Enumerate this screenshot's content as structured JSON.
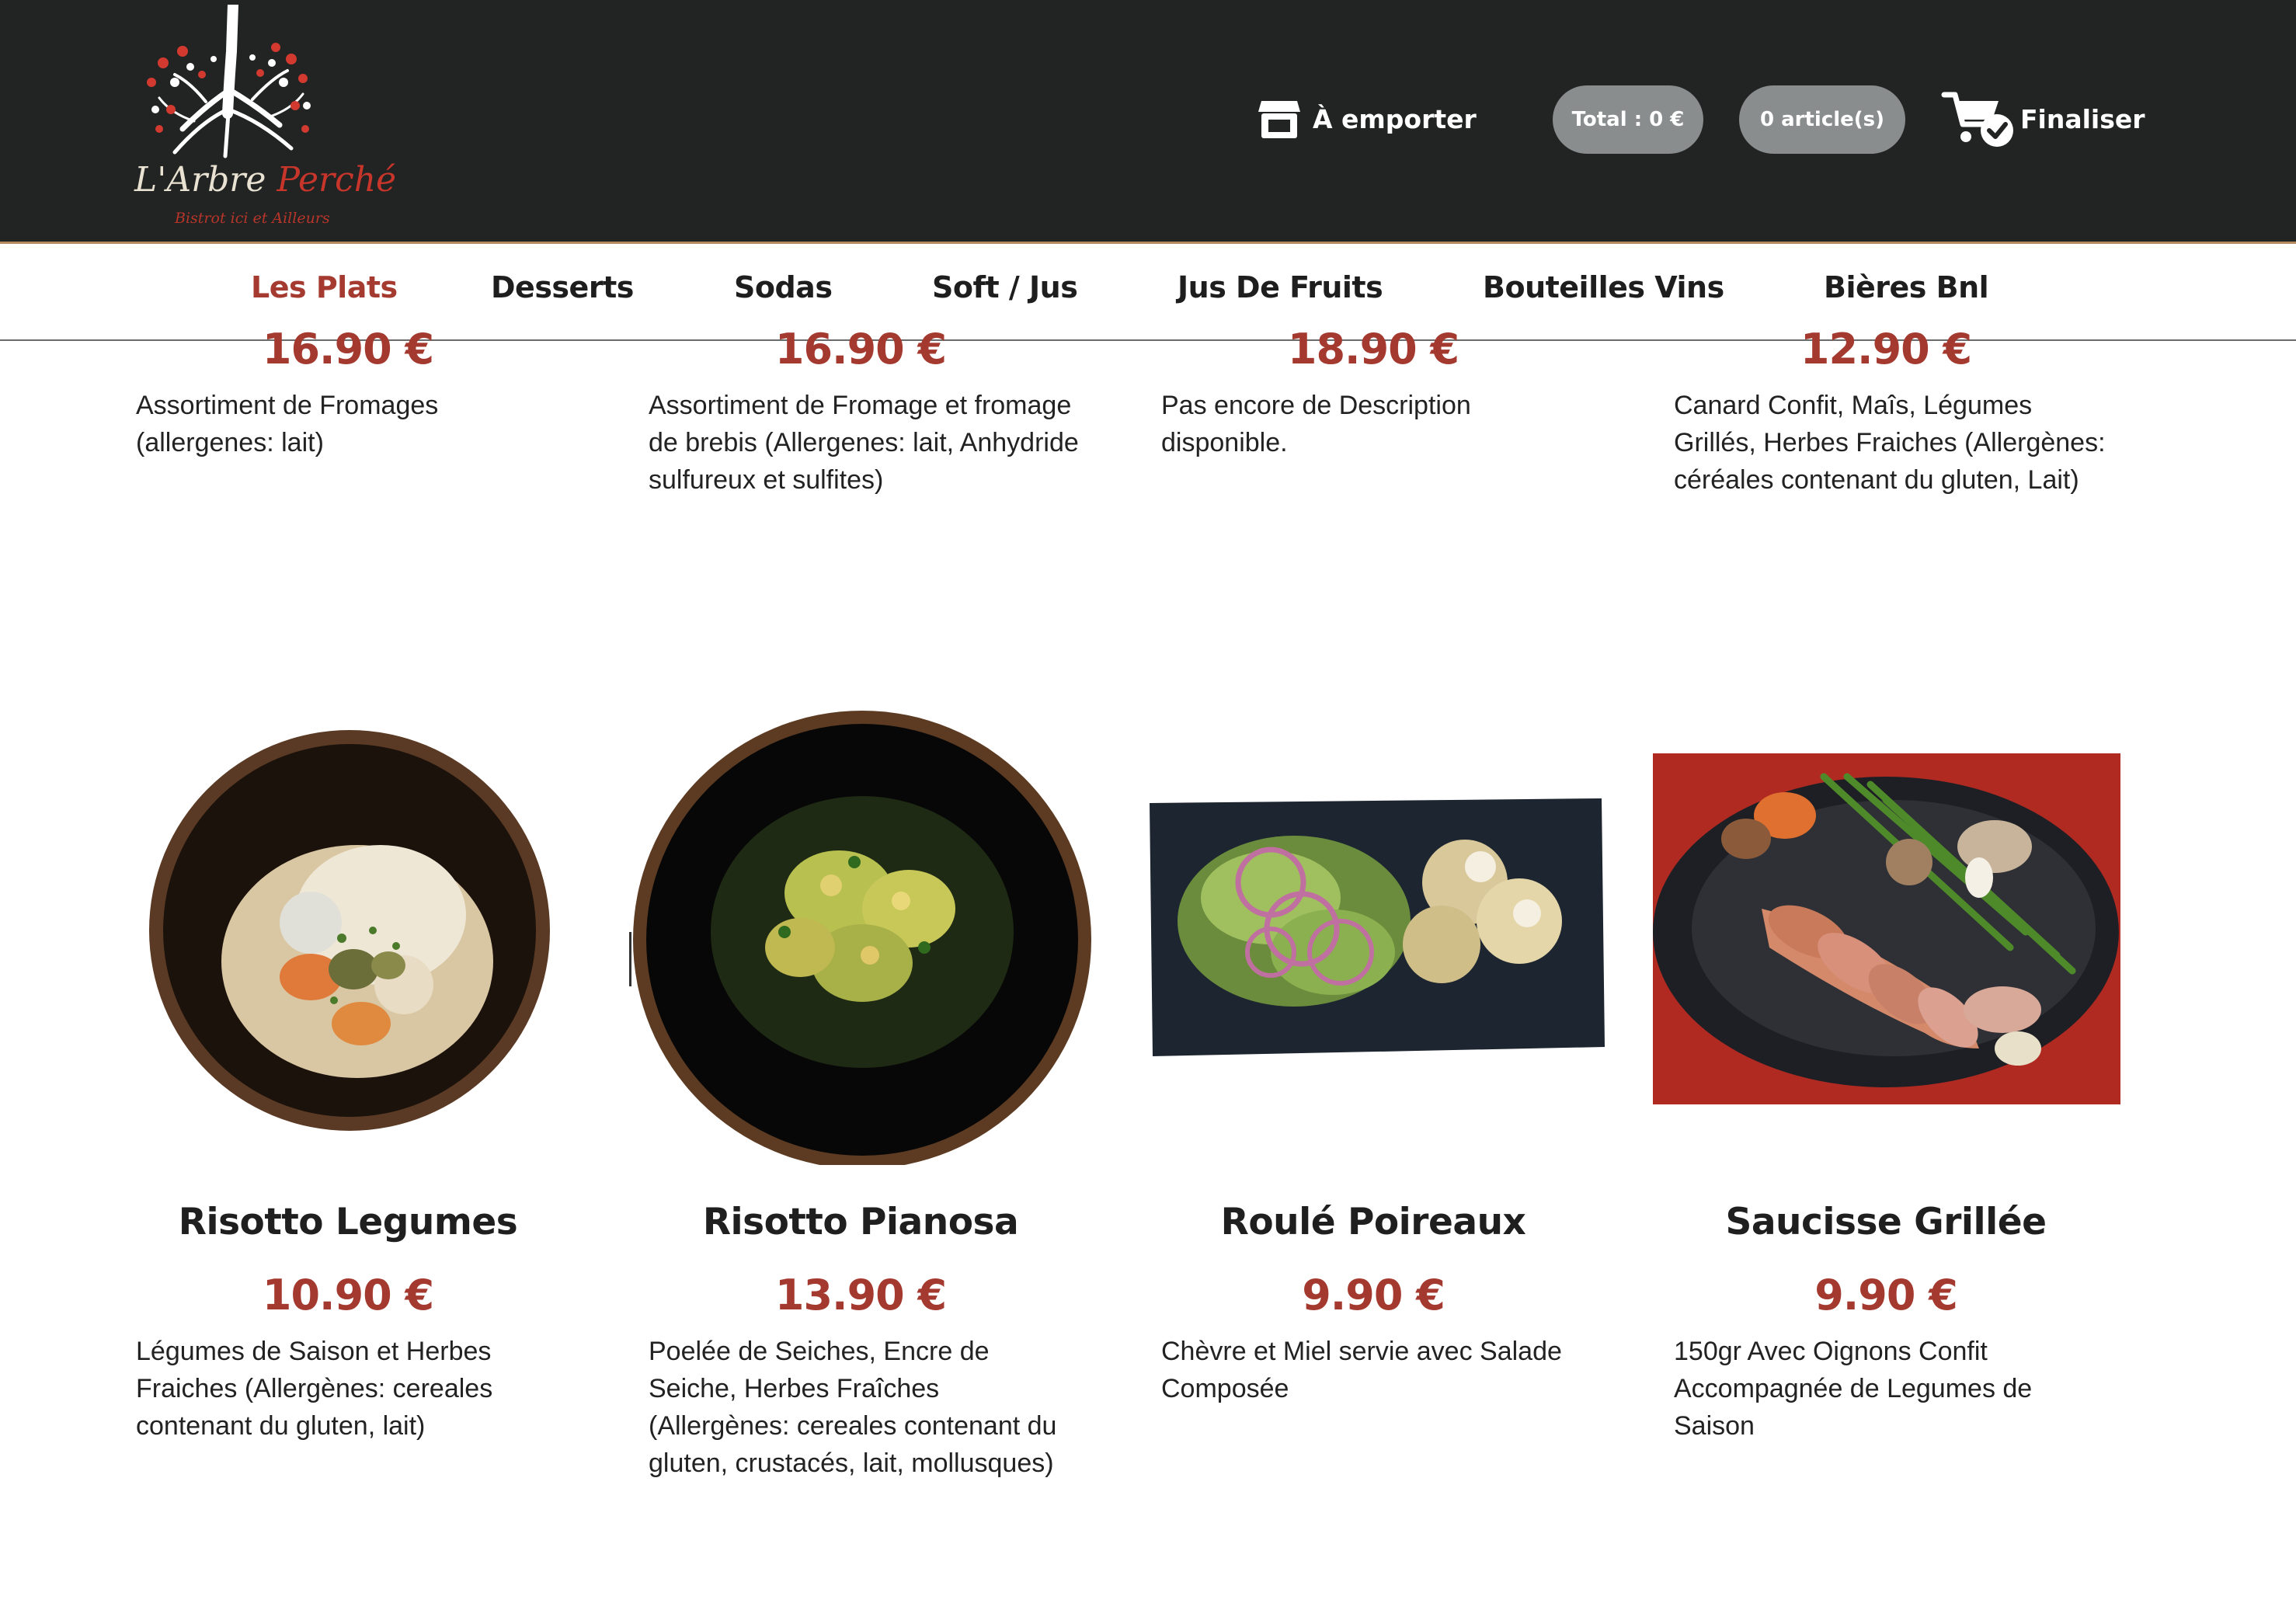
{
  "brand": {
    "name_part1": "L'Arbre",
    "name_part2": "Perché",
    "tagline": "Bistrot ici et Ailleurs"
  },
  "header": {
    "takeaway_label": "À emporter",
    "total_label": "Total : 0 €",
    "items_count_label": "0 article(s)",
    "checkout_label": "Finaliser"
  },
  "categories": [
    {
      "label": "Les Plats",
      "active": true
    },
    {
      "label": "Desserts",
      "active": false
    },
    {
      "label": "Sodas",
      "active": false
    },
    {
      "label": "Soft / Jus",
      "active": false
    },
    {
      "label": "Jus De Fruits",
      "active": false
    },
    {
      "label": "Bouteilles Vins",
      "active": false
    },
    {
      "label": "Bières Bnl",
      "active": false
    }
  ],
  "products_top": [
    {
      "price": "16.90 €",
      "description": "Assortiment de Fromages (allergenes: lait)"
    },
    {
      "price": "16.90 €",
      "description": "Assortiment de Fromage et fromage de brebis (Allergenes: lait, Anhydride sulfureux et sulfites)"
    },
    {
      "price": "18.90 €",
      "description": "Pas encore de Description disponible."
    },
    {
      "price": "12.90 €",
      "description": "Canard Confit, Maîs, Légumes Grillés, Herbes Fraiches (Allergènes: céréales contenant du gluten, Lait)"
    }
  ],
  "products": [
    {
      "name": "Risotto Legumes",
      "price": "10.90 €",
      "description": "Légumes de Saison et Herbes Fraiches (Allergènes: cereales contenant du gluten, lait)"
    },
    {
      "name": "Risotto Pianosa",
      "price": "13.90 €",
      "description": "Poelée de Seiches, Encre de Seiche, Herbes Fraîches (Allergènes: cereales contenant du gluten, crustacés, lait, mollusques)"
    },
    {
      "name": "Roulé Poireaux",
      "price": "9.90 €",
      "description": "Chèvre et Miel servie avec Salade Composée"
    },
    {
      "name": "Saucisse Grillée",
      "price": "9.90 €",
      "description": "150gr Avec Oignons Confit Accompagnée de Legumes de Saison"
    }
  ],
  "colors": {
    "header_bg": "#222423",
    "accent_red": "#a43a2f",
    "pill_bg": "#8a8d8e"
  }
}
